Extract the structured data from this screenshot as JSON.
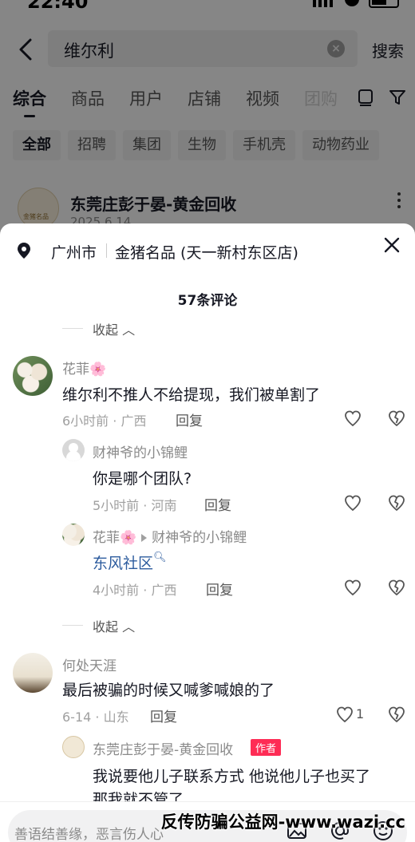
{
  "status_bar": {
    "time": "22:40"
  },
  "search": {
    "query": "维尔利",
    "search_label": "搜索"
  },
  "tabs": [
    "综合",
    "商品",
    "用户",
    "店铺",
    "视频",
    "团购"
  ],
  "chips": [
    "全部",
    "招聘",
    "集团",
    "生物",
    "手机壳",
    "动物药业"
  ],
  "result": {
    "title": "东莞庄彭于晏-黄金回收",
    "date": "2025.6.14"
  },
  "sheet": {
    "location_city": "广州市",
    "location_store": "金猪名品 (天一新村东区店)",
    "comment_count": "57条评论",
    "collapse_label": "收起",
    "comments": [
      {
        "name": "花菲🌸",
        "text": "维尔利不推人不给提现，我们被单割了",
        "meta": "6小时前 · 广西",
        "reply": "回复"
      },
      {
        "name": "财神爷的小锦鲤",
        "text": "你是哪个团队?",
        "meta": "5小时前 · 河南",
        "reply": "回复"
      },
      {
        "name": "花菲🌸",
        "reply_to": "财神爷的小锦鲤",
        "text": "东风社区",
        "meta": "4小时前 · 广西",
        "reply": "回复"
      },
      {
        "name": "何处天涯",
        "text": "最后被骗的时候又喊爹喊娘的了",
        "meta": "6-14 · 山东",
        "reply": "回复",
        "likes": "1"
      },
      {
        "name": "东莞庄彭于晏-黄金回收",
        "author_tag": "作者",
        "text": "我说要他儿子联系方式 他说他儿子也买了",
        "text2": "那我就不管了"
      }
    ]
  },
  "input": {
    "placeholder": "善语结善缘，恶言伤人心"
  },
  "watermark": "反传防骗公益网-www.wazi.cc"
}
